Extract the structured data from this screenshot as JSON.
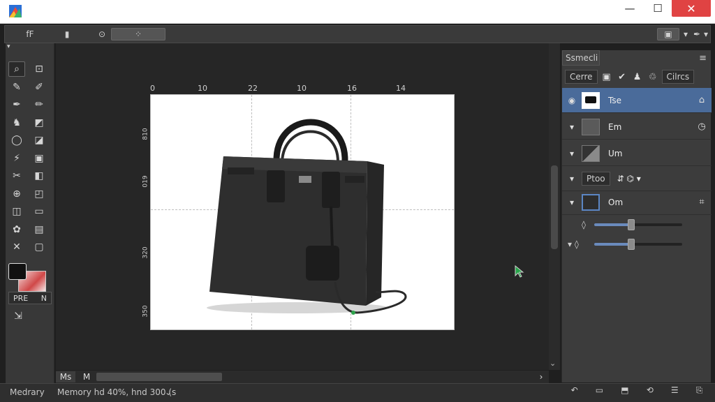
{
  "window": {
    "minimize_label": "—",
    "maximize_label": "☐",
    "close_label": "✕"
  },
  "options_bar": {
    "tool_icon": "move-tool-icon",
    "items": [
      "fF",
      "▮",
      "⊙",
      "⁘"
    ],
    "right_items": [
      "▣",
      "▾",
      "✒",
      "▾"
    ]
  },
  "toolbar": {
    "top_marker": "▾",
    "tools": [
      [
        "⌕",
        "⊡"
      ],
      [
        "✎",
        "✐"
      ],
      [
        "✒",
        "✏"
      ],
      [
        "♞",
        "◩"
      ],
      [
        "◯",
        "◪"
      ],
      [
        "⚡",
        "▣"
      ],
      [
        "✂",
        "◧"
      ],
      [
        "⊕",
        "◰"
      ],
      [
        "◫",
        "▭"
      ],
      [
        "✿",
        "▤"
      ],
      [
        "✕",
        "▢"
      ]
    ],
    "mode_left": "PRE",
    "mode_right": "N",
    "extra_icon": "⇲"
  },
  "canvas": {
    "ruler_top": [
      "0",
      "10",
      "22",
      "10",
      "16",
      "14"
    ],
    "ruler_left": [
      "810",
      "019",
      "320",
      "350"
    ],
    "image_alt": "black leather handbag"
  },
  "scroll": {
    "tab1": "Ms",
    "tab2": "M",
    "arrow_right": "›",
    "arrow_down": "⌄"
  },
  "status": {
    "left": "Medrary",
    "memory": "Memory hd 40%, hnd 300 (s",
    "memory_arrow": "⌄"
  },
  "right_panel": {
    "tab_label": "Ssmecli",
    "menu_icon": "≡",
    "blend_mode": "Cerre",
    "blend_icons": [
      "▣",
      "✔",
      "♟",
      "♲"
    ],
    "blend_select2": "Cilrcs",
    "layers": [
      {
        "name": "Tse",
        "selected": true,
        "left": "◉",
        "right": "⌂"
      },
      {
        "name": "Em",
        "selected": false,
        "left": "▾",
        "right": "◷"
      },
      {
        "name": "Um",
        "selected": false,
        "left": "▾",
        "right": ""
      },
      {
        "name": "Ptoo",
        "selected": false,
        "left": "▾",
        "right": ""
      },
      {
        "name": "Om",
        "selected": false,
        "left": "▾",
        "right": "⌗"
      }
    ],
    "sliders": [
      {
        "icon": "◊",
        "value": 0.42
      },
      {
        "icon": "▾ ◊",
        "value": 0.42
      }
    ],
    "bottom_icons": [
      "↶",
      "▭",
      "⬒",
      "⟲",
      "☰",
      "⎘"
    ]
  },
  "colors": {
    "accent": "#4a6b9a",
    "bg_dark": "#1f1f1f",
    "panel": "#3c3c3c"
  }
}
